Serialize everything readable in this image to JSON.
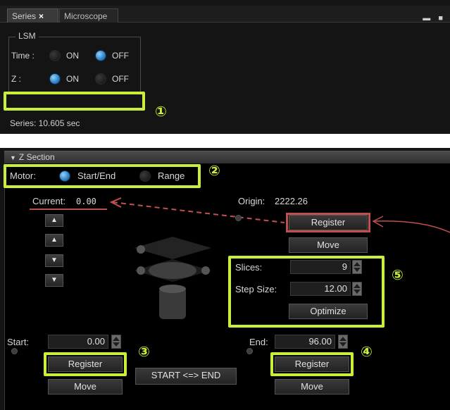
{
  "tabs": [
    {
      "label": "Series",
      "close": "×"
    },
    {
      "label": "Microscope"
    }
  ],
  "window_controls": "▬ ■",
  "lsm": {
    "legend": "LSM",
    "time_label": "Time :",
    "z_label": "Z     :",
    "on_label": "ON",
    "off_label": "OFF",
    "time_selected": "OFF",
    "z_selected": "ON"
  },
  "series_status": "Series: 10.605 sec",
  "annotations": {
    "n1": "①",
    "n2": "②",
    "n3": "③",
    "n4": "④",
    "n5": "⑤",
    "highlight_color": "#c8f03a",
    "arrow_color": "#c0504d"
  },
  "z_section": {
    "header": "Z Section",
    "collapse_icon": "▼",
    "motor_label": "Motor:",
    "mode_start_end": "Start/End",
    "mode_range": "Range",
    "mode_selected": "Start/End",
    "current_label": "Current:",
    "current_value": "0.00",
    "origin_label": "Origin:",
    "origin_value": "2222.26",
    "register_label": "Register",
    "move_label": "Move",
    "arrows": [
      "top-up",
      "up",
      "down",
      "bottom-down"
    ],
    "slices_label": "Slices:",
    "slices_value": "9",
    "step_size_label": "Step Size:",
    "step_size_value": "12.00",
    "optimize_label": "Optimize",
    "start_label": "Start:",
    "start_value": "0.00",
    "end_label": "End:",
    "end_value": "96.00",
    "swap_label": "START <=> END"
  }
}
